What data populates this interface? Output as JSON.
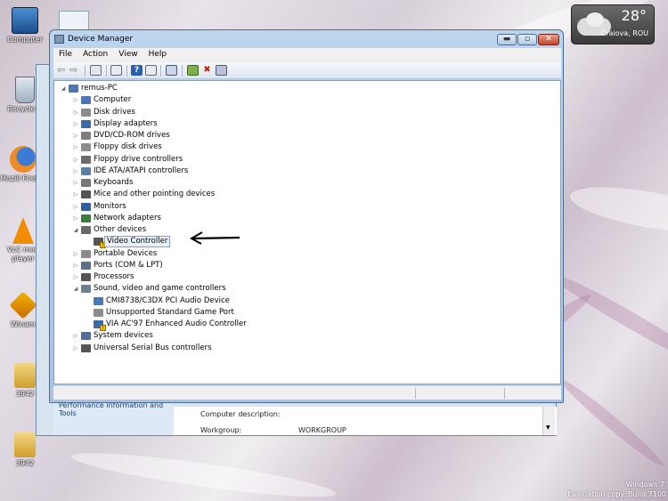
{
  "desktop": {
    "icons": [
      {
        "label": "Computer"
      },
      {
        "label": "Recycle B"
      },
      {
        "label": "Mozill Firefox"
      },
      {
        "label": "VLC med player"
      },
      {
        "label": "Winam"
      },
      {
        "label": "3942"
      },
      {
        "label": "3942"
      }
    ],
    "watermark": {
      "line1": "Windows 7",
      "line2": "Evaluation copy. Build 7100"
    }
  },
  "weather_gadget": {
    "temperature": "28°",
    "city": "Craiova, ROU"
  },
  "background_window": {
    "left_pane_text": "Performance Information and Tools",
    "computer_description_label": "Computer description:",
    "workgroup_label": "Workgroup:",
    "workgroup_value": "WORKGROUP"
  },
  "window": {
    "title": "Device Manager",
    "menu": [
      "File",
      "Action",
      "View",
      "Help"
    ],
    "tree": {
      "root": "remus-PC",
      "items": [
        {
          "label": "Computer",
          "expanded": false
        },
        {
          "label": "Disk drives",
          "expanded": false
        },
        {
          "label": "Display adapters",
          "expanded": false
        },
        {
          "label": "DVD/CD-ROM drives",
          "expanded": false
        },
        {
          "label": "Floppy disk drives",
          "expanded": false
        },
        {
          "label": "Floppy drive controllers",
          "expanded": false
        },
        {
          "label": "IDE ATA/ATAPI controllers",
          "expanded": false
        },
        {
          "label": "Keyboards",
          "expanded": false
        },
        {
          "label": "Mice and other pointing devices",
          "expanded": false
        },
        {
          "label": "Monitors",
          "expanded": false
        },
        {
          "label": "Network adapters",
          "expanded": false
        },
        {
          "label": "Other devices",
          "expanded": true,
          "children": [
            "Video Controller"
          ]
        },
        {
          "label": "Portable Devices",
          "expanded": false
        },
        {
          "label": "Ports (COM & LPT)",
          "expanded": false
        },
        {
          "label": "Processors",
          "expanded": false
        },
        {
          "label": "Sound, video and game controllers",
          "expanded": true,
          "children": [
            "CMI8738/C3DX PCI Audio Device",
            "Unsupported Standard Game Port",
            "VIA AC'97 Enhanced Audio Controller"
          ]
        },
        {
          "label": "System devices",
          "expanded": false
        },
        {
          "label": "Universal Serial Bus controllers",
          "expanded": false
        }
      ]
    }
  },
  "colors": {
    "accent": "#3b6ea5",
    "warning": "#f0c000"
  }
}
